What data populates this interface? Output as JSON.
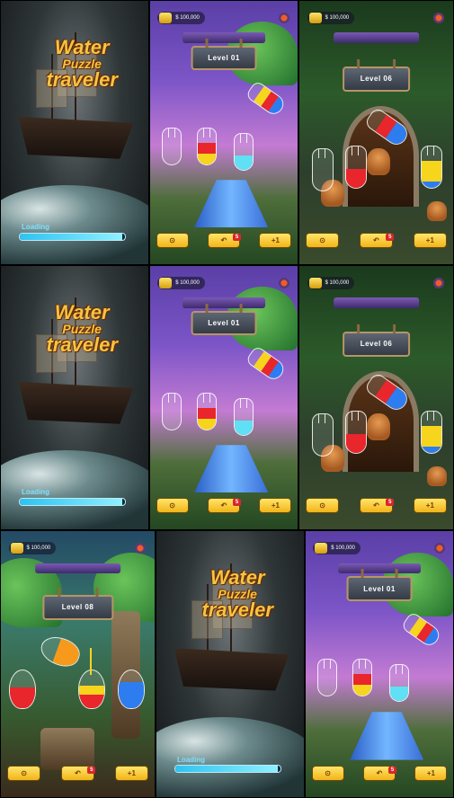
{
  "tiles": [
    {
      "id": "r1c1",
      "type": "loading",
      "logo": {
        "line1": "Water",
        "line2": "Puzzle",
        "line3": "traveler"
      },
      "loading_label": "Loading",
      "progress": 0.97
    },
    {
      "id": "r1c2",
      "type": "level",
      "theme": "purple",
      "coins": "$ 100,000",
      "level": "Level  01",
      "undo_count": "5",
      "add_count": "+1"
    },
    {
      "id": "r1c3",
      "type": "level",
      "theme": "forest",
      "coins": "$ 100,000",
      "level": "Level  06",
      "undo_count": "5",
      "add_count": "+1"
    },
    {
      "id": "r2c1",
      "type": "loading",
      "logo": {
        "line1": "Water",
        "line2": "Puzzle",
        "line3": "traveler"
      },
      "loading_label": "Loading",
      "progress": 0.97
    },
    {
      "id": "r2c2",
      "type": "level",
      "theme": "purple",
      "coins": "$ 100,000",
      "level": "Level  01",
      "undo_count": "5",
      "add_count": "+1"
    },
    {
      "id": "r2c3",
      "type": "level",
      "theme": "forest",
      "coins": "$ 100,000",
      "level": "Level  06",
      "undo_count": "5",
      "add_count": "+1"
    },
    {
      "id": "r3c1",
      "type": "level",
      "theme": "jungle",
      "coins": "$ 100,000",
      "level": "Level  08",
      "undo_count": "5",
      "add_count": "+1"
    },
    {
      "id": "r3c2",
      "type": "loading",
      "logo": {
        "line1": "Water",
        "line2": "Puzzle",
        "line3": "traveler"
      },
      "loading_label": "Loading",
      "progress": 0.97
    },
    {
      "id": "r3c3",
      "type": "level",
      "theme": "purple",
      "coins": "$ 100,000",
      "level": "Level  01",
      "undo_count": "5",
      "add_count": "+1"
    }
  ],
  "colors": {
    "red": "#e8262c",
    "yellow": "#f7d51d",
    "blue": "#2e7df0",
    "cyan": "#5fe0f4",
    "orange": "#f79a1b",
    "button_yellow": "#f2b419",
    "badge_red": "#d9262c"
  },
  "icons": {
    "coins": "coin-stack-icon",
    "settings": "gear-icon",
    "hint": "lightbulb-icon",
    "undo": "undo-arrow-icon",
    "add_tube": "add-tube-icon"
  }
}
